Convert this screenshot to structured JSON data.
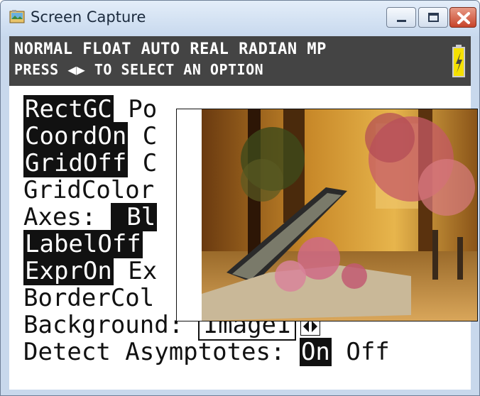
{
  "window": {
    "title": "Screen Capture",
    "icon": "screen-capture-app-icon"
  },
  "buttons": {
    "minimize": "minimize-icon",
    "maximize": "maximize-icon",
    "close": "close-icon"
  },
  "status": {
    "line1": "NORMAL FLOAT AUTO REAL RADIAN MP",
    "line2": "PRESS ◀▶ TO SELECT AN OPTION",
    "battery_icon": "battery-charging-icon"
  },
  "menu": {
    "rect_gc": "RectGC",
    "polar_gc_partial": " Po",
    "coord_on": "CoordOn",
    "coord_partial": " C",
    "grid_off": "GridOff",
    "grid_partial": " C",
    "grid_color": "GridColor",
    "axes_label": "Axes: ",
    "axes_value_partial": " Bl",
    "label_off": "LabelOff",
    "expr_on": "ExprOn",
    "expr_partial": " Ex",
    "border_color_partial": "BorderCol",
    "background_label": "Background:",
    "background_value": "Image1",
    "detect_label": "Detect Asymptotes: ",
    "detect_on": "On",
    "detect_off": " Off"
  },
  "colors": {
    "highlight": "#111111",
    "status_bar": "#444444",
    "battery": "#f5e000"
  }
}
